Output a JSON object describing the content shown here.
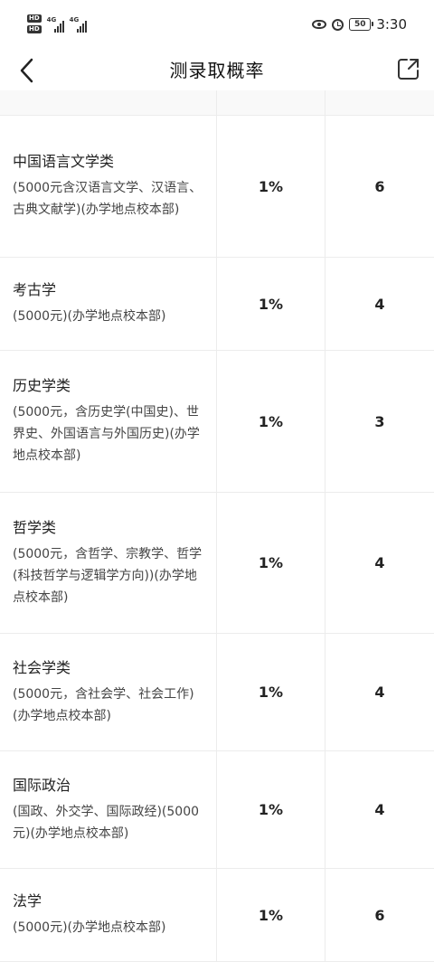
{
  "status_bar": {
    "network_1": "4G",
    "network_2": "4G",
    "battery": "50",
    "time": "3:30"
  },
  "header": {
    "title": "测录取概率"
  },
  "rows": [
    {
      "name": "中国语言文学类",
      "note": "(5000元含汉语言文学、汉语言、古典文献学)(办学地点校本部)",
      "rate": "1%",
      "plan": "6"
    },
    {
      "name": "考古学",
      "note": "(5000元)(办学地点校本部)",
      "rate": "1%",
      "plan": "4"
    },
    {
      "name": "历史学类",
      "note": "(5000元，含历史学(中国史)、世界史、外国语言与外国历史)(办学地点校本部)",
      "rate": "1%",
      "plan": "3"
    },
    {
      "name": "哲学类",
      "note": "(5000元，含哲学、宗教学、哲学(科技哲学与逻辑学方向))(办学地点校本部)",
      "rate": "1%",
      "plan": "4"
    },
    {
      "name": "社会学类",
      "note": "(5000元，含社会学、社会工作)(办学地点校本部)",
      "rate": "1%",
      "plan": "4"
    },
    {
      "name": "国际政治",
      "note": "(国政、外交学、国际政经)(5000元)(办学地点校本部)",
      "rate": "1%",
      "plan": "4"
    },
    {
      "name": "法学",
      "note": "(5000元)(办学地点校本部)",
      "rate": "1%",
      "plan": "6"
    }
  ]
}
